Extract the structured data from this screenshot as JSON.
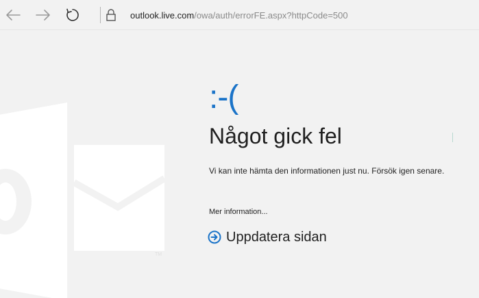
{
  "browser": {
    "address": {
      "host": "outlook.live.com",
      "path": "/owa/auth/errorFE.aspx?httpCode=500"
    }
  },
  "error_page": {
    "emoticon": ":-(",
    "title": "Något gick fel",
    "description": "Vi kan inte hämta den informationen just nu. Försök igen senare.",
    "more_info": "Mer information...",
    "refresh_label": "Uppdatera sidan"
  },
  "colors": {
    "accent": "#1a73c8",
    "background": "#f2f2f2",
    "text": "#1f1f1f"
  }
}
